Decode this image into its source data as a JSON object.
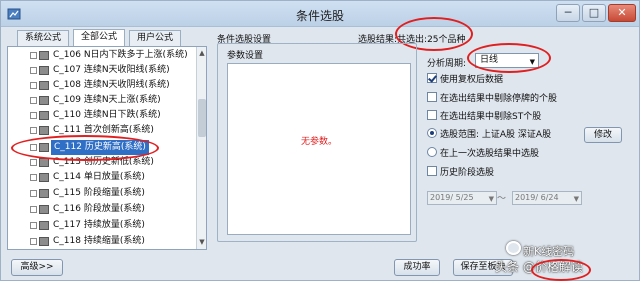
{
  "window": {
    "title": "条件选股",
    "min_glyph": "─",
    "max_glyph": "□",
    "close_glyph": "✕"
  },
  "tabs": [
    {
      "label": "系统公式"
    },
    {
      "label": "全部公式"
    },
    {
      "label": "用户公式"
    }
  ],
  "tree": {
    "items": [
      "C_106 N日内下跌多于上涨(系统)",
      "C_107 连续N天收阳线(系统)",
      "C_108 连续N天收阴线(系统)",
      "C_109 连续N天上涨(系统)",
      "C_110 连续N日下跌(系统)",
      "C_111 首次创新高(系统)",
      "C_112 历史新高(系统)",
      "C_113 创历史新低(系统)",
      "C_114 单日放量(系统)",
      "C_115 阶段缩量(系统)",
      "C_116 阶段放量(系统)",
      "C_117 持续放量(系统)",
      "C_118 持续缩量(系统)"
    ],
    "selected_index": 6,
    "scroll_up": "▲",
    "scroll_down": "▼"
  },
  "settings_label": "条件选股设置",
  "result_label": "选股结果:共选出:25个品种",
  "params": {
    "group_title": "参数设置",
    "empty_text": "无参数。"
  },
  "period": {
    "label": "分析周期:",
    "value": "日线",
    "arrow": "▼"
  },
  "options": {
    "use_adjusted": {
      "label": "使用复权后数据",
      "checked": true
    },
    "remove_suspended": {
      "label": "在选出结果中剔除停牌的个股",
      "checked": false
    },
    "remove_st": {
      "label": "在选出结果中剔除ST个股",
      "checked": false
    },
    "range": {
      "label": "选股范围: 上证A股 深证A股",
      "selected": true
    },
    "prev_result": {
      "label": "在上一次选股结果中选股",
      "selected": false
    },
    "history": {
      "label": "历史阶段选股",
      "checked": false
    }
  },
  "edit_button": "修改",
  "date_from": {
    "value": "2019/ 5/25",
    "arrow": "▼"
  },
  "date_to": {
    "value": "2019/ 6/24",
    "arrow": "▼"
  },
  "date_sep": "～",
  "buttons": {
    "advanced": "高级>>",
    "formula": "成功率",
    "save": "保存至板块"
  },
  "watermark": {
    "line1": "新K线密码",
    "line2": "头条 @价格解读"
  },
  "colors": {
    "selection": "#2f6fc6",
    "highlight_oval": "#e02020",
    "empty_param_text": "#e02020"
  }
}
